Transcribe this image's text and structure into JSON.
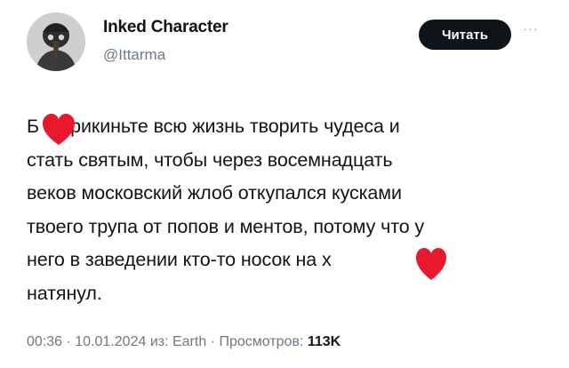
{
  "author": {
    "display_name": "Inked Character",
    "handle": "@Ittarma",
    "avatar_icon": "plague-doctor-avatar"
  },
  "actions": {
    "follow_label": "Читать",
    "more_label": "···"
  },
  "tweet": {
    "lines": [
      "Б   а прикиньте всю жизнь творить чудеса и",
      "стать святым, чтобы через восемнадцать",
      "веков московский жлоб откупался кусками",
      "твоего трупа от попов и ментов, потому что у",
      "него в заведении кто-то носок на х",
      "натянул."
    ],
    "censor_color": "#e8192c",
    "censor_icons": [
      "heart-censor-icon",
      "heart-censor-icon"
    ]
  },
  "meta": {
    "time": "00:36",
    "date": "10.01.2024",
    "source_prefix": "из:",
    "source": "Earth",
    "views_label": "Просмотров:",
    "views_count": "113K"
  }
}
